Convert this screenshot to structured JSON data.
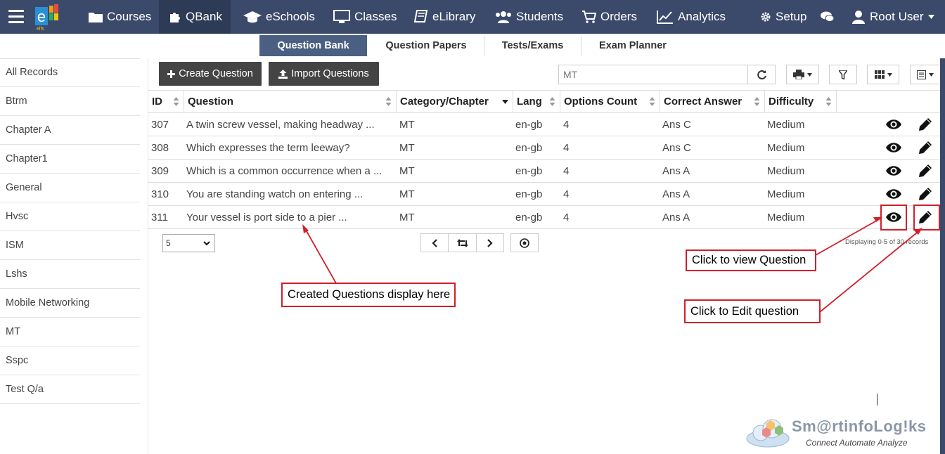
{
  "topnav": {
    "logo_text": "elfs",
    "items": [
      {
        "label": "Courses",
        "icon": "folder-icon"
      },
      {
        "label": "QBank",
        "icon": "puzzle-icon"
      },
      {
        "label": "eSchools",
        "icon": "graduation-cap-icon"
      },
      {
        "label": "Classes",
        "icon": "monitor-icon"
      },
      {
        "label": "eLibrary",
        "icon": "book-icon"
      },
      {
        "label": "Students",
        "icon": "users-icon"
      },
      {
        "label": "Orders",
        "icon": "cart-icon"
      },
      {
        "label": "Analytics",
        "icon": "line-chart-icon"
      },
      {
        "label": "Setup",
        "icon": "gear-icon"
      },
      {
        "label": "",
        "icon": "chat-icon"
      },
      {
        "label": "Root User",
        "icon": "user-icon"
      }
    ],
    "active": "QBank"
  },
  "subnav": {
    "tabs": [
      "Question Bank",
      "Question Papers",
      "Tests/Exams",
      "Exam Planner"
    ],
    "active": "Question Bank"
  },
  "sidebar": {
    "items": [
      "All Records",
      "Btrm",
      "Chapter A",
      "Chapter1",
      "General",
      "Hvsc",
      "ISM",
      "Lshs",
      "Mobile Networking",
      "MT",
      "Sspc",
      "Test Q/a"
    ]
  },
  "toolbar": {
    "create_label": "Create Question",
    "import_label": "Import Questions",
    "search_value": "MT"
  },
  "table": {
    "columns": [
      "ID",
      "Question",
      "Category/Chapter",
      "Lang",
      "Options Count",
      "Correct Answer",
      "Difficulty"
    ],
    "rows": [
      {
        "id": "307",
        "question": "A twin screw vessel, making headway ...",
        "category": "MT",
        "lang": "en-gb",
        "options": "4",
        "answer": "Ans C",
        "difficulty": "Medium"
      },
      {
        "id": "308",
        "question": "Which expresses the term leeway?",
        "category": "MT",
        "lang": "en-gb",
        "options": "4",
        "answer": "Ans C",
        "difficulty": "Medium"
      },
      {
        "id": "309",
        "question": "Which is a common occurrence when a ...",
        "category": "MT",
        "lang": "en-gb",
        "options": "4",
        "answer": "Ans A",
        "difficulty": "Medium"
      },
      {
        "id": "310",
        "question": "You are standing watch on entering ...",
        "category": "MT",
        "lang": "en-gb",
        "options": "4",
        "answer": "Ans A",
        "difficulty": "Medium"
      },
      {
        "id": "311",
        "question": "Your vessel is port side to a pier ...",
        "category": "MT",
        "lang": "en-gb",
        "options": "4",
        "answer": "Ans A",
        "difficulty": "Medium"
      }
    ]
  },
  "pagination": {
    "page_size": "5",
    "displaying": "Displaying 0-5 of 30 records"
  },
  "annotations": {
    "created_questions": "Created Questions display here",
    "view_question": "Click to view Question",
    "edit_question": "Click to Edit question",
    "color": "#d0202a"
  },
  "brand": {
    "name": "Sm@rtinfoLog!ks",
    "tagline": "Connect Automate Analyze"
  },
  "colors": {
    "nav_bg": "#3b4a6b",
    "nav_active": "#2e3b56",
    "subtab_active": "#4a5f82",
    "dark_button": "#444444"
  }
}
